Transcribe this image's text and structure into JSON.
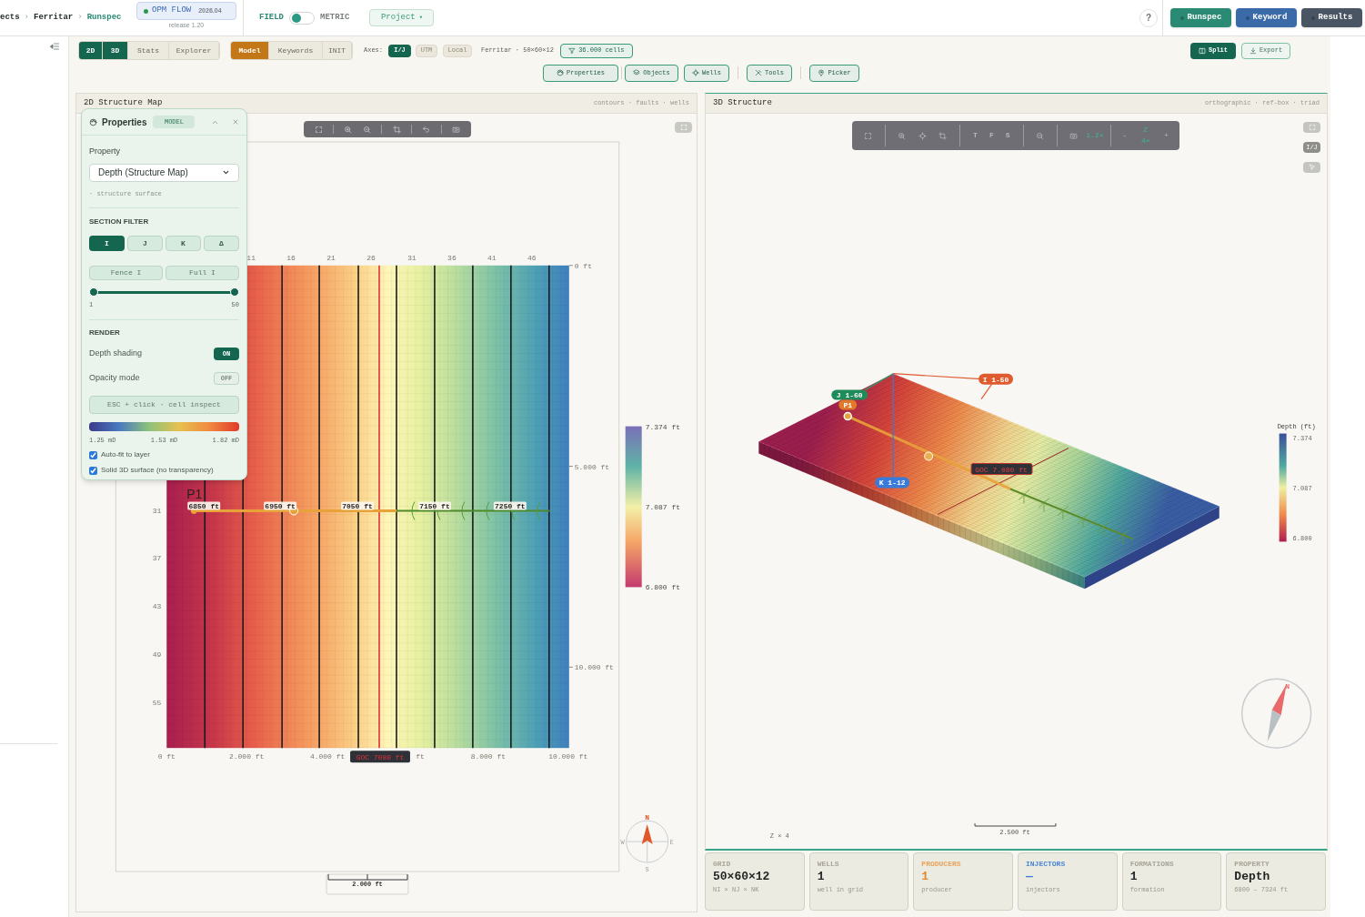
{
  "breadcrumb": [
    {
      "kind": "crumb",
      "label": "ects",
      "selected": false
    },
    {
      "kind": "sep",
      "label": "›"
    },
    {
      "kind": "crumb",
      "label": "Ferritar",
      "selected": false
    },
    {
      "kind": "sep",
      "label": "›"
    },
    {
      "kind": "crumb",
      "label": "Runspec",
      "selected": true
    }
  ],
  "engine_badge": {
    "name": "OPM FLOW",
    "version": "2026.04",
    "release": "release 1.20"
  },
  "units": [
    {
      "label": "FIELD",
      "selected": true
    },
    {
      "label": "METRIC",
      "selected": false
    }
  ],
  "project_menu": {
    "label": "Project",
    "caret": "▾"
  },
  "help": "?",
  "modes": [
    {
      "label": "Runspec",
      "color": "#2a8a74"
    },
    {
      "label": "Keyword",
      "color": "#3a6aa8"
    },
    {
      "label": "Results",
      "color": "#4a5563"
    }
  ],
  "view_tabs": [
    {
      "label": "2D",
      "selected": true
    },
    {
      "label": "3D",
      "selected": true
    },
    {
      "label": "Stats",
      "selected": false
    },
    {
      "label": "Explorer",
      "selected": false
    }
  ],
  "data_tabs": [
    {
      "label": "Model",
      "selected": true
    },
    {
      "label": "Keywords",
      "selected": false
    },
    {
      "label": "INIT",
      "selected": false
    }
  ],
  "axes": {
    "label": "Axes:",
    "options": [
      {
        "label": "I/J",
        "selected": true
      },
      {
        "label": "UTM",
        "selected": false
      },
      {
        "label": "Local",
        "selected": false
      }
    ]
  },
  "model_info": "Ferritar · 50×60×12",
  "cell_filter": "36.000 cells",
  "panel_buttons": [
    {
      "label": "Properties"
    },
    {
      "label": "Objects"
    },
    {
      "label": "Wells"
    },
    {
      "label": "Tools"
    },
    {
      "label": "Picker"
    }
  ],
  "layout_buttons": [
    {
      "label": "Split",
      "selected": true
    },
    {
      "label": "Export",
      "selected": false
    }
  ],
  "map2d": {
    "title": "2D Structure Map",
    "subtitle": "contours · faults · wells",
    "column_labels": [
      "11",
      "16",
      "21",
      "26",
      "31",
      "36",
      "41",
      "46"
    ],
    "row_labels": [
      "31",
      "37",
      "43",
      "49",
      "55"
    ],
    "y_ticks": [
      "0 ft",
      "5.000 ft",
      "10.000 ft"
    ],
    "x_ticks": [
      "0 ft",
      "2.000 ft",
      "4.000 ft",
      "ft",
      "8.000 ft",
      "10.000 ft"
    ],
    "goc_label": "GOC 7080 ft",
    "well": {
      "name": "P1",
      "depth_labels": [
        "6850 ft",
        "6950 ft",
        "7050 ft",
        "7150 ft",
        "7250 ft"
      ]
    },
    "colorbar": [
      "7.374 ft",
      "7.087 ft",
      "6.800 ft"
    ],
    "compass": {
      "n": "N",
      "w": "W",
      "e": "E",
      "s": "S"
    },
    "scale": "2.000 ft"
  },
  "properties_panel": {
    "title": "Properties",
    "badge": "MODEL",
    "property_label": "Property",
    "property_value": "Depth (Structure Map)",
    "hint": "· structure surface",
    "section_title": "SECTION FILTER",
    "section_axes": [
      {
        "label": "I",
        "selected": true
      },
      {
        "label": "J",
        "selected": false
      },
      {
        "label": "K",
        "selected": false
      },
      {
        "label": "Δ",
        "selected": false
      }
    ],
    "fence_buttons": [
      "Fence I",
      "Full I"
    ],
    "slider": {
      "level": 1,
      "min": "1",
      "max": "50"
    },
    "render_title": "RENDER",
    "toggles": [
      {
        "label": "Depth shading",
        "on": true,
        "text": "ON"
      },
      {
        "label": "Opacity mode",
        "on": false,
        "text": "OFF"
      }
    ],
    "inspect_hint": "ESC + click · cell inspect",
    "legend": [
      "1.25 mD",
      "1.53 mD",
      "1.82 mD"
    ],
    "checkboxes": [
      {
        "label": "Auto-fit to layer",
        "checked": true
      },
      {
        "label": "Solid 3D surface (no transparency)",
        "checked": true
      }
    ]
  },
  "view3d": {
    "title": "3D Structure",
    "subtitle": "orthographic · ref-box · triad",
    "toolbar": {
      "views": [
        "T",
        "F",
        "S"
      ],
      "zoom": "1.2×",
      "minus": "-",
      "z_label": "Z",
      "z_value": "4×",
      "plus": "+"
    },
    "ij_button": "I/J",
    "i_range": "I 1-50",
    "j_range": "J 1-60",
    "k_range": "K 1-12",
    "well": "P1",
    "goc": "GOC 7.080 ft",
    "colorbar_title": "Depth (ft)",
    "colorbar": [
      "7.374",
      "7.087",
      "6.800"
    ],
    "compass_n": "N",
    "z_note": "Z × 4",
    "scale": "2.500 ft"
  },
  "stats": [
    {
      "label": "GRID",
      "color": "#a8a498",
      "value": {
        "text": "50×60×12",
        "color": "#1f2421"
      },
      "sub": "NI × NJ × NK"
    },
    {
      "label": "WELLS",
      "color": "#a8a498",
      "value": {
        "text": "1",
        "color": "#1f2421"
      },
      "sub": "well in grid"
    },
    {
      "label": "PRODUCERS",
      "color": "#e8a25a",
      "value": {
        "text": "1",
        "color": "#e0892e"
      },
      "sub": "producer"
    },
    {
      "label": "INJECTORS",
      "color": "#4a86d8",
      "value": {
        "text": "—",
        "color": "#3b7bd6"
      },
      "sub": "injectors"
    },
    {
      "label": "FORMATIONS",
      "color": "#a8a498",
      "value": {
        "text": "1",
        "color": "#1f2421"
      },
      "sub": "formation"
    },
    {
      "label": "PROPERTY",
      "color": "#a8a498",
      "value": {
        "text": "Depth",
        "color": "#1f2421"
      },
      "sub": "6800 – 7324 ft"
    }
  ]
}
